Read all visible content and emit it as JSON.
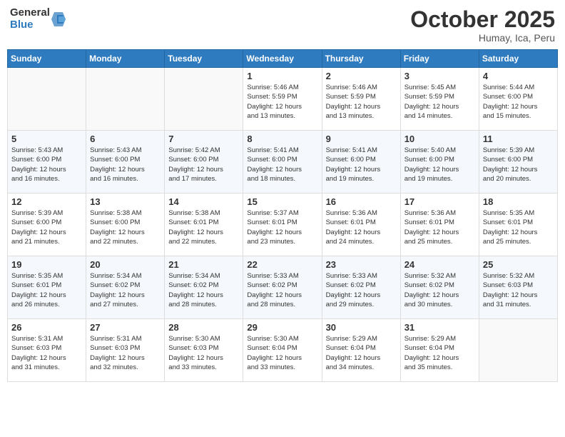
{
  "logo": {
    "general": "General",
    "blue": "Blue"
  },
  "header": {
    "month": "October 2025",
    "location": "Humay, Ica, Peru"
  },
  "weekdays": [
    "Sunday",
    "Monday",
    "Tuesday",
    "Wednesday",
    "Thursday",
    "Friday",
    "Saturday"
  ],
  "weeks": [
    [
      {
        "day": "",
        "info": ""
      },
      {
        "day": "",
        "info": ""
      },
      {
        "day": "",
        "info": ""
      },
      {
        "day": "1",
        "info": "Sunrise: 5:46 AM\nSunset: 5:59 PM\nDaylight: 12 hours\nand 13 minutes."
      },
      {
        "day": "2",
        "info": "Sunrise: 5:46 AM\nSunset: 5:59 PM\nDaylight: 12 hours\nand 13 minutes."
      },
      {
        "day": "3",
        "info": "Sunrise: 5:45 AM\nSunset: 5:59 PM\nDaylight: 12 hours\nand 14 minutes."
      },
      {
        "day": "4",
        "info": "Sunrise: 5:44 AM\nSunset: 6:00 PM\nDaylight: 12 hours\nand 15 minutes."
      }
    ],
    [
      {
        "day": "5",
        "info": "Sunrise: 5:43 AM\nSunset: 6:00 PM\nDaylight: 12 hours\nand 16 minutes."
      },
      {
        "day": "6",
        "info": "Sunrise: 5:43 AM\nSunset: 6:00 PM\nDaylight: 12 hours\nand 16 minutes."
      },
      {
        "day": "7",
        "info": "Sunrise: 5:42 AM\nSunset: 6:00 PM\nDaylight: 12 hours\nand 17 minutes."
      },
      {
        "day": "8",
        "info": "Sunrise: 5:41 AM\nSunset: 6:00 PM\nDaylight: 12 hours\nand 18 minutes."
      },
      {
        "day": "9",
        "info": "Sunrise: 5:41 AM\nSunset: 6:00 PM\nDaylight: 12 hours\nand 19 minutes."
      },
      {
        "day": "10",
        "info": "Sunrise: 5:40 AM\nSunset: 6:00 PM\nDaylight: 12 hours\nand 19 minutes."
      },
      {
        "day": "11",
        "info": "Sunrise: 5:39 AM\nSunset: 6:00 PM\nDaylight: 12 hours\nand 20 minutes."
      }
    ],
    [
      {
        "day": "12",
        "info": "Sunrise: 5:39 AM\nSunset: 6:00 PM\nDaylight: 12 hours\nand 21 minutes."
      },
      {
        "day": "13",
        "info": "Sunrise: 5:38 AM\nSunset: 6:00 PM\nDaylight: 12 hours\nand 22 minutes."
      },
      {
        "day": "14",
        "info": "Sunrise: 5:38 AM\nSunset: 6:01 PM\nDaylight: 12 hours\nand 22 minutes."
      },
      {
        "day": "15",
        "info": "Sunrise: 5:37 AM\nSunset: 6:01 PM\nDaylight: 12 hours\nand 23 minutes."
      },
      {
        "day": "16",
        "info": "Sunrise: 5:36 AM\nSunset: 6:01 PM\nDaylight: 12 hours\nand 24 minutes."
      },
      {
        "day": "17",
        "info": "Sunrise: 5:36 AM\nSunset: 6:01 PM\nDaylight: 12 hours\nand 25 minutes."
      },
      {
        "day": "18",
        "info": "Sunrise: 5:35 AM\nSunset: 6:01 PM\nDaylight: 12 hours\nand 25 minutes."
      }
    ],
    [
      {
        "day": "19",
        "info": "Sunrise: 5:35 AM\nSunset: 6:01 PM\nDaylight: 12 hours\nand 26 minutes."
      },
      {
        "day": "20",
        "info": "Sunrise: 5:34 AM\nSunset: 6:02 PM\nDaylight: 12 hours\nand 27 minutes."
      },
      {
        "day": "21",
        "info": "Sunrise: 5:34 AM\nSunset: 6:02 PM\nDaylight: 12 hours\nand 28 minutes."
      },
      {
        "day": "22",
        "info": "Sunrise: 5:33 AM\nSunset: 6:02 PM\nDaylight: 12 hours\nand 28 minutes."
      },
      {
        "day": "23",
        "info": "Sunrise: 5:33 AM\nSunset: 6:02 PM\nDaylight: 12 hours\nand 29 minutes."
      },
      {
        "day": "24",
        "info": "Sunrise: 5:32 AM\nSunset: 6:02 PM\nDaylight: 12 hours\nand 30 minutes."
      },
      {
        "day": "25",
        "info": "Sunrise: 5:32 AM\nSunset: 6:03 PM\nDaylight: 12 hours\nand 31 minutes."
      }
    ],
    [
      {
        "day": "26",
        "info": "Sunrise: 5:31 AM\nSunset: 6:03 PM\nDaylight: 12 hours\nand 31 minutes."
      },
      {
        "day": "27",
        "info": "Sunrise: 5:31 AM\nSunset: 6:03 PM\nDaylight: 12 hours\nand 32 minutes."
      },
      {
        "day": "28",
        "info": "Sunrise: 5:30 AM\nSunset: 6:03 PM\nDaylight: 12 hours\nand 33 minutes."
      },
      {
        "day": "29",
        "info": "Sunrise: 5:30 AM\nSunset: 6:04 PM\nDaylight: 12 hours\nand 33 minutes."
      },
      {
        "day": "30",
        "info": "Sunrise: 5:29 AM\nSunset: 6:04 PM\nDaylight: 12 hours\nand 34 minutes."
      },
      {
        "day": "31",
        "info": "Sunrise: 5:29 AM\nSunset: 6:04 PM\nDaylight: 12 hours\nand 35 minutes."
      },
      {
        "day": "",
        "info": ""
      }
    ]
  ]
}
